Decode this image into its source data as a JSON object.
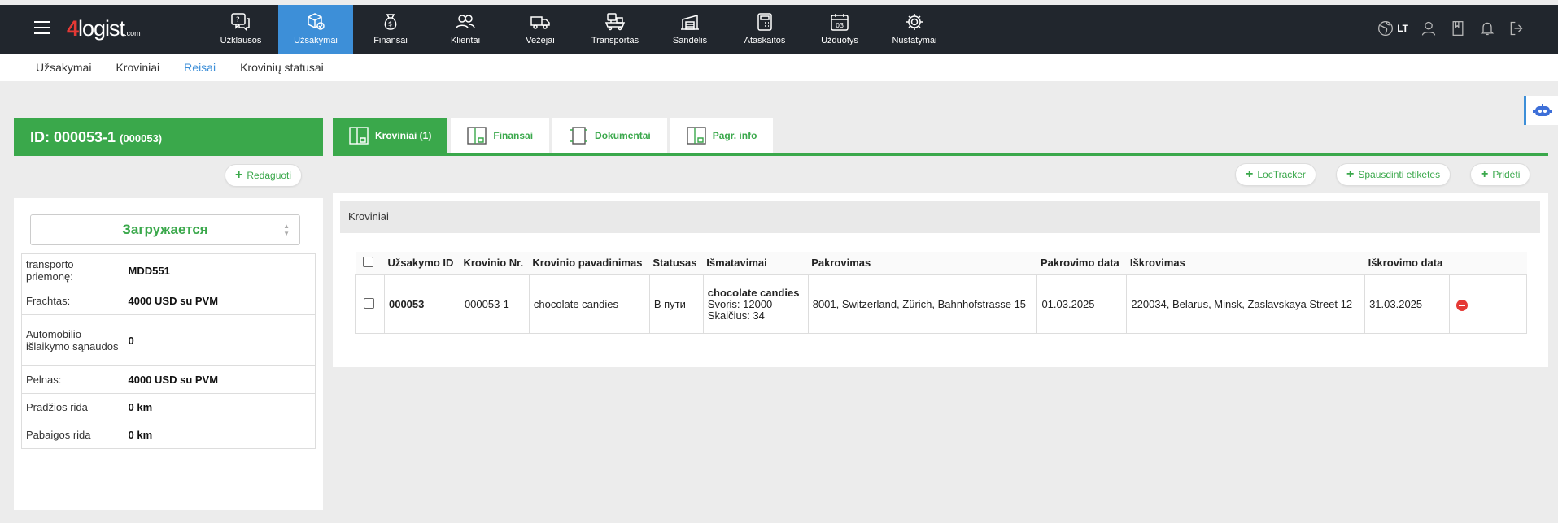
{
  "app": {
    "logo_num": "4",
    "logo_text": "logist",
    "logo_suffix": ".com",
    "accent": "#3aa84b",
    "nav_active": "#3d8fd8"
  },
  "nav": {
    "items": [
      {
        "label": "Užklausos",
        "icon": "question-chat-icon"
      },
      {
        "label": "Užsakymai",
        "icon": "package-check-icon"
      },
      {
        "label": "Finansai",
        "icon": "money-bag-icon"
      },
      {
        "label": "Klientai",
        "icon": "users-icon"
      },
      {
        "label": "Vežėjai",
        "icon": "truck-icon"
      },
      {
        "label": "Transportas",
        "icon": "transport-icon"
      },
      {
        "label": "Sandėlis",
        "icon": "warehouse-icon"
      },
      {
        "label": "Ataskaitos",
        "icon": "calculator-icon"
      },
      {
        "label": "Užduotys",
        "icon": "calendar-icon"
      },
      {
        "label": "Nustatymai",
        "icon": "gear-icon"
      }
    ],
    "lang": "LT"
  },
  "subnav": {
    "items": [
      "Užsakymai",
      "Kroviniai",
      "Reisai",
      "Krovinių statusai"
    ]
  },
  "left": {
    "id_label": "ID: 000053-1",
    "id_sub": "(000053)",
    "edit_label": "Redaguoti",
    "status": "Загружается",
    "info": [
      {
        "k": "transporto priemonę:",
        "v": "MDD551"
      },
      {
        "k": "Frachtas:",
        "v": "4000 USD su PVM"
      },
      {
        "k": "Automobilio išlaikymo sąnaudos",
        "v": "0"
      },
      {
        "k": "Pelnas:",
        "v": "4000 USD su PVM"
      },
      {
        "k": "Pradžios rida",
        "v": "0 km"
      },
      {
        "k": "Pabaigos rida",
        "v": "0 km"
      }
    ]
  },
  "tabs": [
    {
      "label": "Kroviniai (1)"
    },
    {
      "label": "Finansai"
    },
    {
      "label": "Dokumentai"
    },
    {
      "label": "Pagr. info"
    }
  ],
  "toolbar": {
    "loctracker": "LocTracker",
    "print_labels": "Spausdinti etiketes",
    "add": "Pridėti"
  },
  "section_title": "Kroviniai",
  "table": {
    "headers": [
      "Užsakymo ID",
      "Krovinio Nr.",
      "Krovinio pavadinimas",
      "Statusas",
      "Išmatavimai",
      "Pakrovimas",
      "Pakrovimo data",
      "Iškrovimas",
      "Iškrovimo data"
    ],
    "rows": [
      {
        "order_id": "000053",
        "cargo_no": "000053-1",
        "cargo_name": "chocolate candies",
        "status": "В пути",
        "dim_name": "chocolate candies",
        "dim_weight": "Svoris: 12000",
        "dim_count": "Skaičius: 34",
        "loading": "8001, Switzerland, Zürich, Bahnhofstrasse 15",
        "loading_date": "01.03.2025",
        "unloading": "220034, Belarus, Minsk, Zaslavskaya Street 12",
        "unloading_date": "31.03.2025"
      }
    ]
  }
}
